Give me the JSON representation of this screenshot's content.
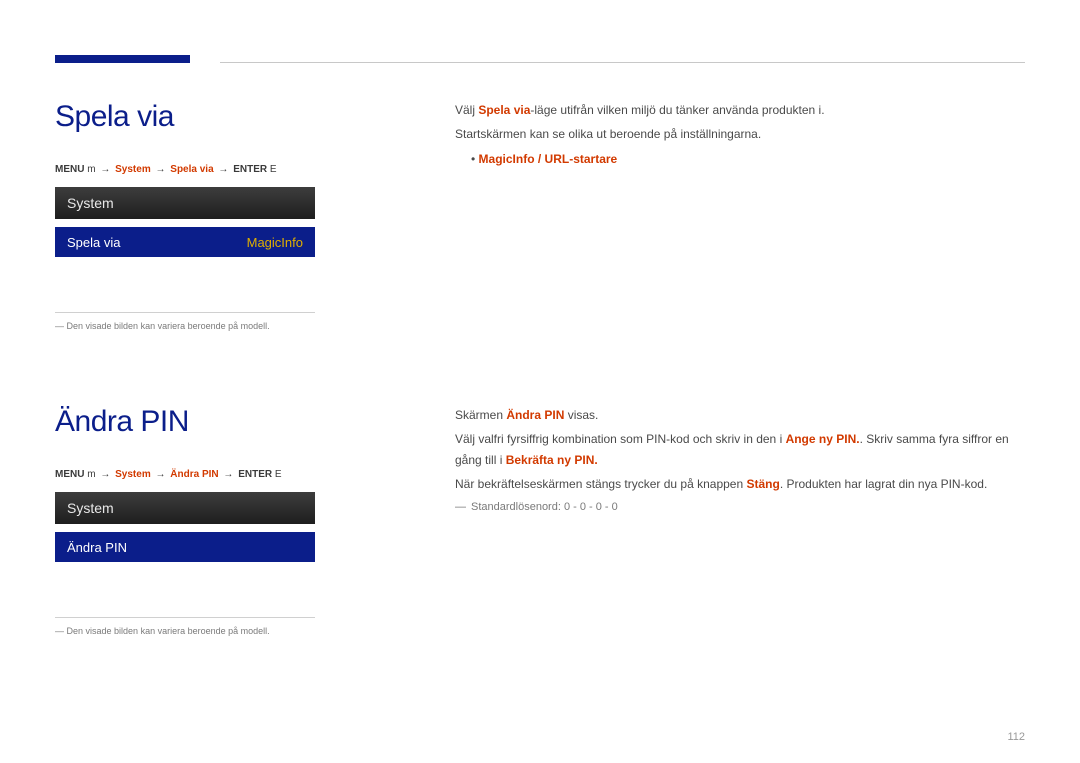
{
  "header": {},
  "section1": {
    "heading": "Spela via",
    "breadcrumb": {
      "key1": "MENU",
      "key1_suffix": "m",
      "arrow": "→",
      "step1": "System",
      "step2": "Spela via",
      "key2": "ENTER",
      "key2_suffix": "E"
    },
    "navbox": {
      "title": "System",
      "row_label": "Spela via",
      "row_value": "MagicInfo"
    },
    "footnote": "Den visade bilden kan variera beroende på modell."
  },
  "body1": {
    "p1_pre": "Välj ",
    "p1_bold": "Spela via",
    "p1_post": "-läge utifrån vilken miljö du tänker använda produkten i.",
    "p2": "Startskärmen kan se olika ut beroende på inställningarna.",
    "opt_bullet": "•",
    "opt_text": "MagicInfo / URL-startare"
  },
  "section2": {
    "heading": "Ändra PIN",
    "breadcrumb": {
      "key1": "MENU",
      "key1_suffix": "m",
      "arrow": "→",
      "step1": "System",
      "step2": "Ändra PIN",
      "key2": "ENTER",
      "key2_suffix": "E"
    },
    "navbox": {
      "title": "System",
      "row_label": "Ändra PIN"
    },
    "footnote": "Den visade bilden kan variera beroende på modell."
  },
  "body2": {
    "p1_pre": "Skärmen ",
    "p1_bold": "Ändra PIN",
    "p1_post": " visas.",
    "p2_pre": "Välj valfri fyrsiffrig kombination som PIN-kod och skriv in den i ",
    "p2_b1": "Ange ny PIN.",
    "p2_mid": ". Skriv samma fyra siffror en gång till i ",
    "p2_b2": "Bekräfta ny PIN.",
    "p3_pre": "När bekräftelseskärmen stängs trycker du på knappen ",
    "p3_bold": "Stäng",
    "p3_post": ". Produkten har lagrat din nya PIN-kod.",
    "note": "Standardlösenord: 0 - 0 - 0 - 0"
  },
  "pagenum": "112"
}
